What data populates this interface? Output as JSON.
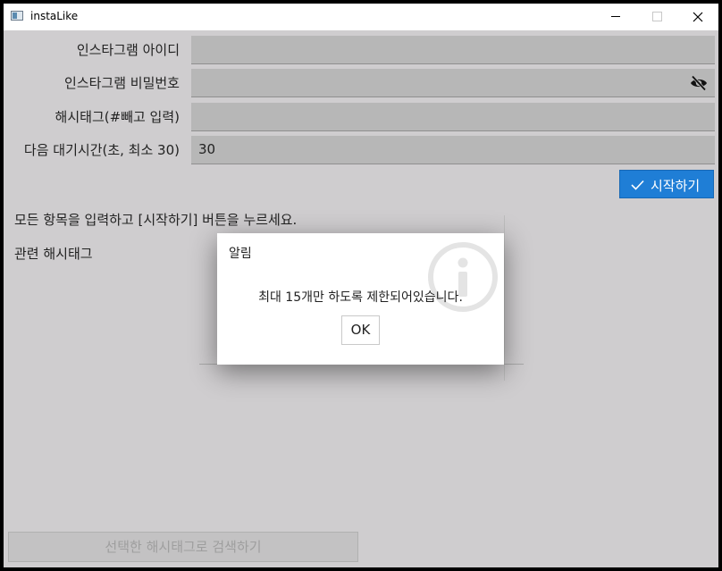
{
  "window": {
    "title": "instaLike"
  },
  "form": {
    "id_label": "인스타그램 아이디",
    "id_value": "",
    "password_label": "인스타그램 비밀번호",
    "password_value": "",
    "hashtag_label": "해시태그(#빼고 입력)",
    "hashtag_value": "",
    "wait_label": "다음 대기시간(초, 최소 30)",
    "wait_value": "30"
  },
  "start_button": {
    "label": "시작하기"
  },
  "status": {
    "message": "모든 항목을 입력하고 [시작하기] 버튼을 누르세요."
  },
  "related": {
    "label": "관련 해시태그"
  },
  "search_button": {
    "label": "선택한 해시태그로 검색하기"
  },
  "dialog": {
    "title": "알림",
    "message": "최대 15개만 하도록 제한되어있습니다.",
    "ok_label": "OK"
  },
  "colors": {
    "accent": "#1f7ed6",
    "window_bg": "#cfcdcf",
    "input_bg": "#b7b7b7"
  },
  "icons": {
    "password_toggle": "eye-slash-icon",
    "start": "check-icon",
    "dialog": "info-icon"
  }
}
